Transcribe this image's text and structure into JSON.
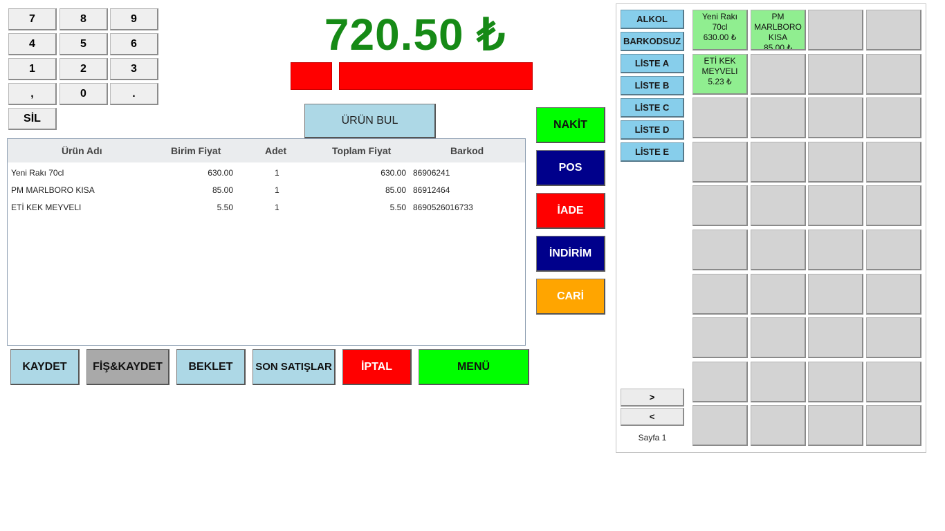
{
  "keypad": {
    "keys": [
      "7",
      "8",
      "9",
      "4",
      "5",
      "6",
      "1",
      "2",
      "3",
      ",",
      "0",
      "."
    ],
    "delete_label": "SİL"
  },
  "total": {
    "amount": "720.50 ₺"
  },
  "find_button": "ÜRÜN BUL",
  "table": {
    "headers": {
      "name": "Ürün Adı",
      "unit_price": "Birim Fiyat",
      "qty": "Adet",
      "total_price": "Toplam Fiyat",
      "barcode": "Barkod"
    },
    "rows": [
      {
        "name": "Yeni Rakı 70cl",
        "unit_price": "630.00",
        "qty": "1",
        "total_price": "630.00",
        "barcode": "86906241"
      },
      {
        "name": "PM MARLBORO KISA",
        "unit_price": "85.00",
        "qty": "1",
        "total_price": "85.00",
        "barcode": "86912464"
      },
      {
        "name": "ETİ KEK MEYVELI",
        "unit_price": "5.50",
        "qty": "1",
        "total_price": "5.50",
        "barcode": "8690526016733"
      }
    ]
  },
  "payment": {
    "cash": "NAKİT",
    "pos": "POS",
    "refund": "İADE",
    "discount": "İNDİRİM",
    "account": "CARİ"
  },
  "bottom": {
    "save": "KAYDET",
    "receipt_save": "FİŞ&KAYDET",
    "hold": "BEKLET",
    "recent_sales": "SON SATIŞLAR",
    "cancel": "İPTAL",
    "menu": "MENÜ"
  },
  "categories": [
    "ALKOL",
    "BARKODSUZ",
    "LİSTE A",
    "LİSTE B",
    "LİSTE C",
    "LİSTE D",
    "LİSTE E"
  ],
  "products": [
    {
      "name": "Yeni Rakı 70cl",
      "price": "630.00 ₺"
    },
    {
      "name": "PM MARLBORO KISA",
      "price": "85.00 ₺"
    },
    {
      "name": "ETİ KEK MEYVELI",
      "price": "5.23 ₺"
    }
  ],
  "pager": {
    "next": ">",
    "prev": "<",
    "page_label": "Sayfa 1"
  },
  "colors": {
    "total": "#168a16",
    "cash": "#00ff00",
    "pos": "#00008b",
    "refund": "#ff0000",
    "discount": "#00008b",
    "account": "#ffa500",
    "category": "#87ceeb",
    "product_tile": "#90ee90",
    "empty_tile": "#d3d3d3"
  }
}
